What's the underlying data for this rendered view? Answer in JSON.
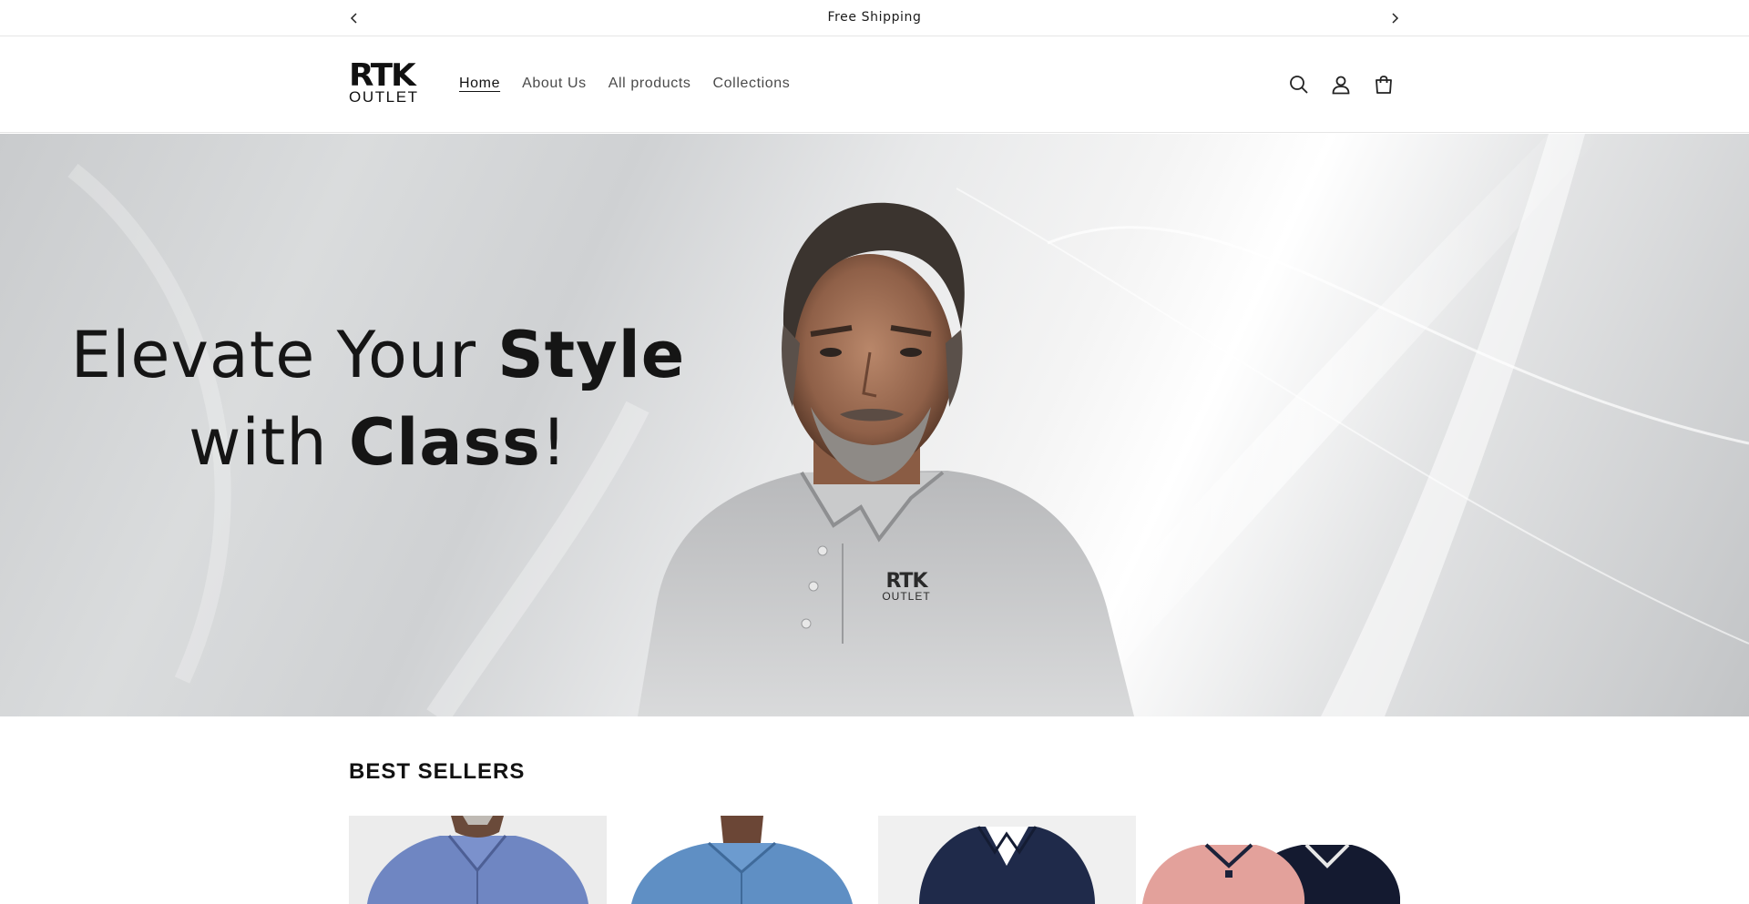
{
  "announcement": {
    "text": "Free Shipping",
    "prev_icon": "chevron-left-icon",
    "next_icon": "chevron-right-icon"
  },
  "header": {
    "logo": {
      "mark": "RTK",
      "sub": "OUTLET"
    },
    "nav": [
      {
        "label": "Home",
        "active": true
      },
      {
        "label": "About Us",
        "active": false
      },
      {
        "label": "All products",
        "active": false
      },
      {
        "label": "Collections",
        "active": false
      }
    ],
    "icons": [
      "search-icon",
      "account-icon",
      "cart-icon"
    ]
  },
  "hero": {
    "line1_regular": "Elevate Your ",
    "line1_bold": "Style",
    "line2_regular": "with ",
    "line2_bold": "Class",
    "line2_end": "!",
    "shirt_logo": {
      "mark": "RTK",
      "sub": "OUTLET"
    }
  },
  "best_sellers": {
    "title": "BEST SELLERS",
    "products": [
      {
        "image": "blue denim button-down shirt"
      },
      {
        "image": "light blue denim shirt"
      },
      {
        "image": "navy short-sleeve shirt"
      },
      {
        "image": "pink and navy polo shirts"
      }
    ]
  },
  "colors": {
    "text": "#121212",
    "muted": "#4a4a4a",
    "border": "#e6e6e6"
  }
}
